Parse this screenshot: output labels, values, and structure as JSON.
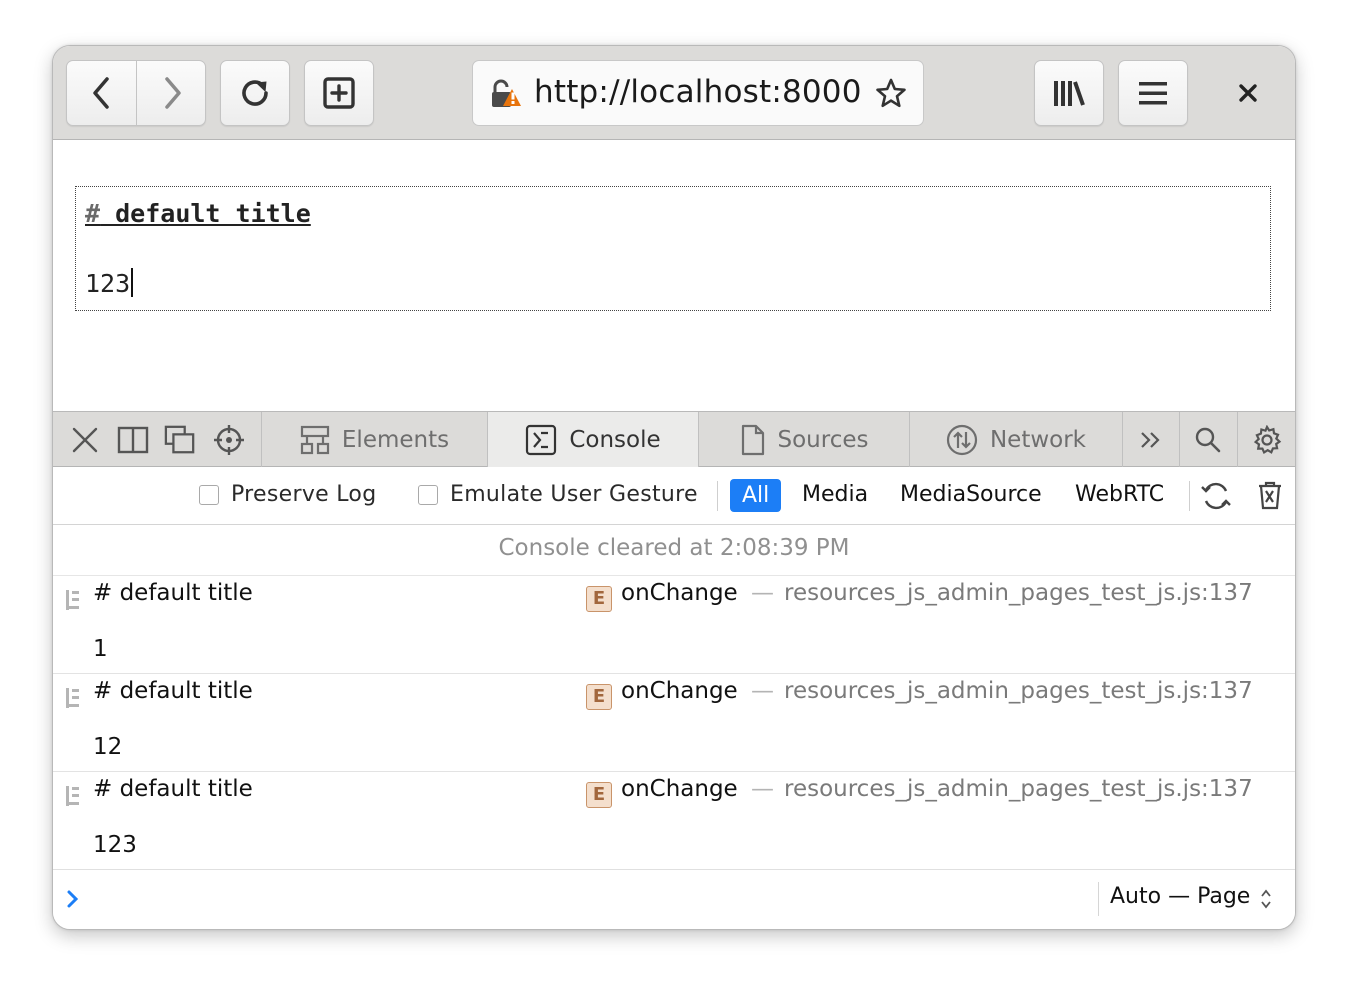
{
  "browser": {
    "url": "http://localhost:8000",
    "icons": {
      "back": "chevron-left-icon",
      "forward": "chevron-right-icon",
      "reload": "reload-icon",
      "new_tab": "plus-square-icon",
      "security": "insecure-lock-icon",
      "bookmark": "star-icon",
      "library": "library-icon",
      "menu": "hamburger-icon",
      "close": "close-icon"
    }
  },
  "page": {
    "editor": {
      "hash": "#",
      "title": " default title",
      "body": "123"
    }
  },
  "devtools": {
    "tabs": [
      {
        "label": "Elements",
        "icon": "elements-icon"
      },
      {
        "label": "Console",
        "icon": "console-icon"
      },
      {
        "label": "Sources",
        "icon": "file-icon"
      },
      {
        "label": "Network",
        "icon": "network-icon"
      }
    ],
    "filters": {
      "preserve_log": {
        "label": "Preserve Log",
        "checked": false
      },
      "emulate_gesture": {
        "label": "Emulate User Gesture",
        "checked": false
      },
      "tags": [
        "All",
        "Media",
        "MediaSource",
        "WebRTC"
      ],
      "selected_tag": "All"
    },
    "console": {
      "cleared_message": "Console cleared at 2:08:39 PM",
      "entries": [
        {
          "message": "# default title",
          "value": "1",
          "badge": "E",
          "function": "onChange",
          "separator": "—",
          "source": "resources_js_admin_pages_test_js.js:137"
        },
        {
          "message": "# default title",
          "value": "12",
          "badge": "E",
          "function": "onChange",
          "separator": "—",
          "source": "resources_js_admin_pages_test_js.js:137"
        },
        {
          "message": "# default title",
          "value": "123",
          "badge": "E",
          "function": "onChange",
          "separator": "—",
          "source": "resources_js_admin_pages_test_js.js:137"
        }
      ],
      "context": "Auto — Page"
    }
  },
  "colors": {
    "accent": "#1c7ef6",
    "toolbar": "#dcdbd9",
    "warning_badge": "#e8740c"
  }
}
